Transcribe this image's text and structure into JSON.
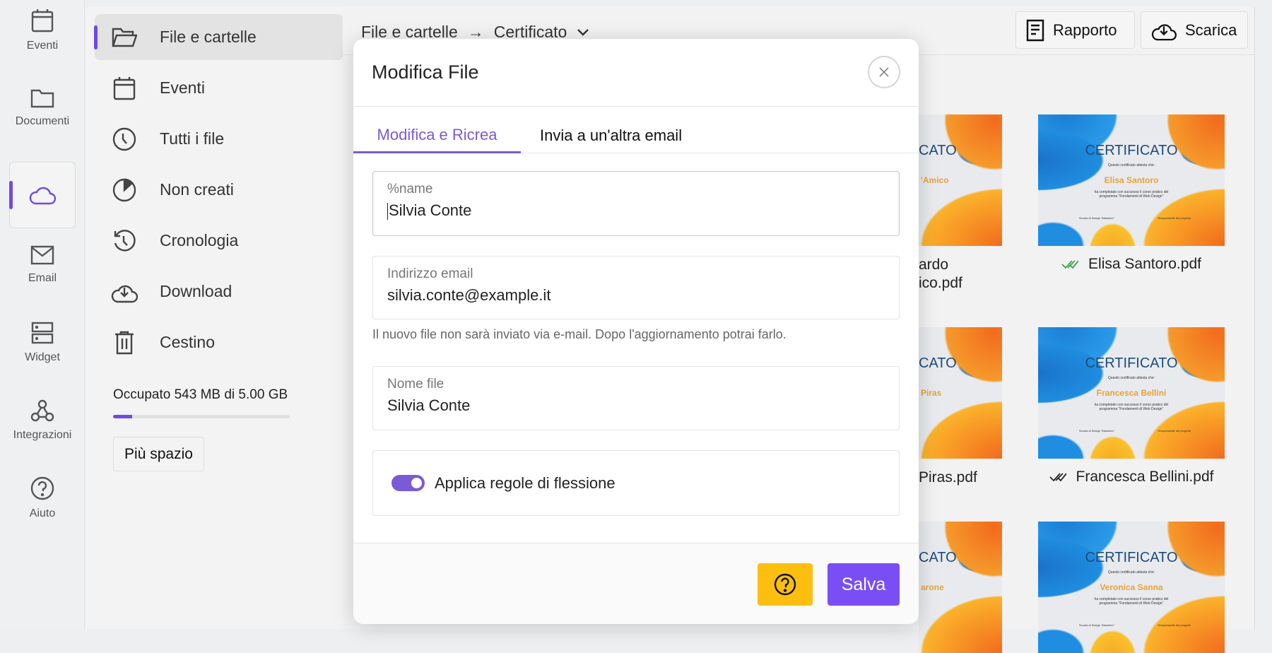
{
  "rail": {
    "items": [
      {
        "label": "Eventi",
        "icon": "calendar-icon"
      },
      {
        "label": "Documenti",
        "icon": "folder-icon"
      },
      {
        "label": "",
        "icon": "cloud-icon",
        "active": true
      },
      {
        "label": "Email",
        "icon": "mail-icon"
      },
      {
        "label": "Widget",
        "icon": "server-icon"
      },
      {
        "label": "Integrazioni",
        "icon": "webhook-icon"
      },
      {
        "label": "Aiuto",
        "icon": "help-icon"
      }
    ]
  },
  "sidebar": {
    "items": [
      {
        "label": "File e cartelle",
        "icon": "folder-open-icon",
        "active": true
      },
      {
        "label": "Eventi",
        "icon": "calendar-icon"
      },
      {
        "label": "Tutti i file",
        "icon": "clock-icon"
      },
      {
        "label": "Non creati",
        "icon": "pie-icon"
      },
      {
        "label": "Cronologia",
        "icon": "history-icon"
      },
      {
        "label": "Download",
        "icon": "cloud-download-icon"
      },
      {
        "label": "Cestino",
        "icon": "trash-icon"
      }
    ],
    "storage_text": "Occupato 543 MB di 5.00 GB",
    "storage_used_percent": 10.6,
    "more_space": "Più spazio"
  },
  "header": {
    "crumb_root": "File e cartelle",
    "crumb_arrow": "→",
    "crumb_current": "Certificato",
    "report": "Rapporto",
    "download": "Scarica"
  },
  "files": {
    "cert_title": "CERTIFICATO",
    "cert_line1": "Questo certificato attesta che:",
    "cert_line2": "ha completato con successo il corso pratico del programma \"Fondamenti di Web Design\"",
    "cert_school": "Scuola di Design \"Massimo\"",
    "cert_resp": "Responsabile del progetto",
    "partial": [
      {
        "cert_fragment": "CATO",
        "name_fragment": "'Amico",
        "file_line1": "ardo",
        "file_line2": "ico.pdf"
      },
      {
        "cert_fragment": "CATO",
        "name_fragment": "Piras",
        "file_line1": "Piras.pdf",
        "file_line2": ""
      },
      {
        "cert_fragment": "CATO",
        "name_fragment": "arone",
        "file_line1": "",
        "file_line2": ""
      }
    ],
    "full": [
      {
        "name": "Elisa Santoro",
        "file": "Elisa Santoro.pdf",
        "status": "delivered",
        "status_color": "#3aa34a"
      },
      {
        "name": "Francesca Bellini",
        "file": "Francesca Bellini.pdf",
        "status": "sent",
        "status_color": "#222222"
      },
      {
        "name": "Veronica Sanna",
        "file": "",
        "status": ""
      }
    ]
  },
  "modal": {
    "title": "Modifica File",
    "tabs": [
      "Modifica e Ricrea",
      "Invia a un'altra email"
    ],
    "fields": [
      {
        "label": "%name",
        "value": "Silvia Conte"
      },
      {
        "label": "Indirizzo email",
        "value": "silvia.conte@example.it"
      },
      {
        "label": "Nome file",
        "value": "Silvia Conte"
      }
    ],
    "hint": "Il nuovo file non sarà inviato via e-mail. Dopo l'aggiornamento potrai farlo.",
    "toggle_label": "Applica regole di flessione",
    "toggle_on": true,
    "save": "Salva"
  },
  "colors": {
    "accent": "#7048e8",
    "help_button": "#fdbf0f",
    "save_button": "#7a4ef5"
  }
}
